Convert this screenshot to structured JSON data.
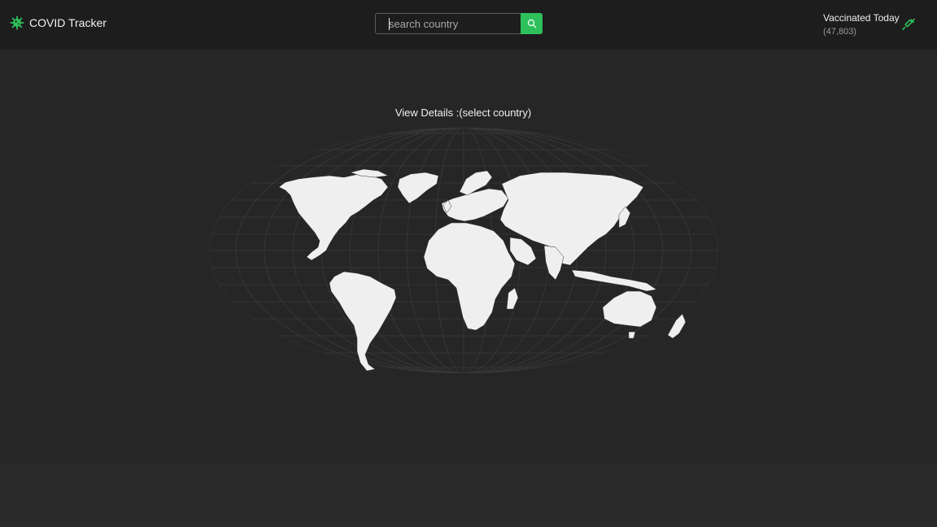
{
  "app": {
    "title": "COVID Tracker",
    "logo_icon": "virus-icon"
  },
  "search": {
    "placeholder": "search country",
    "value": "",
    "button_icon": "search-icon"
  },
  "vaccinated": {
    "title": "Vaccinated Today",
    "count": "(47,803)",
    "icon": "syringe-icon"
  },
  "main": {
    "details_label": "View Details :(select country)"
  },
  "colors": {
    "accent": "#2ec05a",
    "topbar_bg": "#1d1d1e",
    "main_bg": "#262626",
    "footer_bg": "#2a2a2a",
    "land": "#efefef"
  }
}
